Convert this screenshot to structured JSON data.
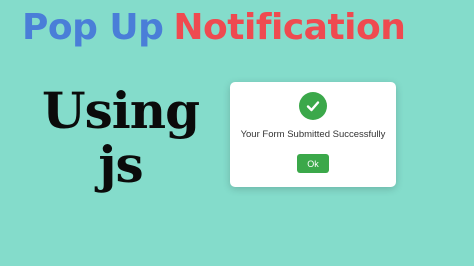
{
  "header": {
    "title_part1": "Pop Up",
    "title_part2": "Notification",
    "title_part1_color": "#4a7ed8",
    "title_part2_color": "#ef4a50"
  },
  "subtitle": {
    "line1": "Using",
    "line2": "js"
  },
  "popup": {
    "icon": "check-circle-icon",
    "icon_color": "#3ba84a",
    "message": "Your Form Submitted Successfully",
    "ok_label": "Ok"
  },
  "background_color": "#84dccb"
}
